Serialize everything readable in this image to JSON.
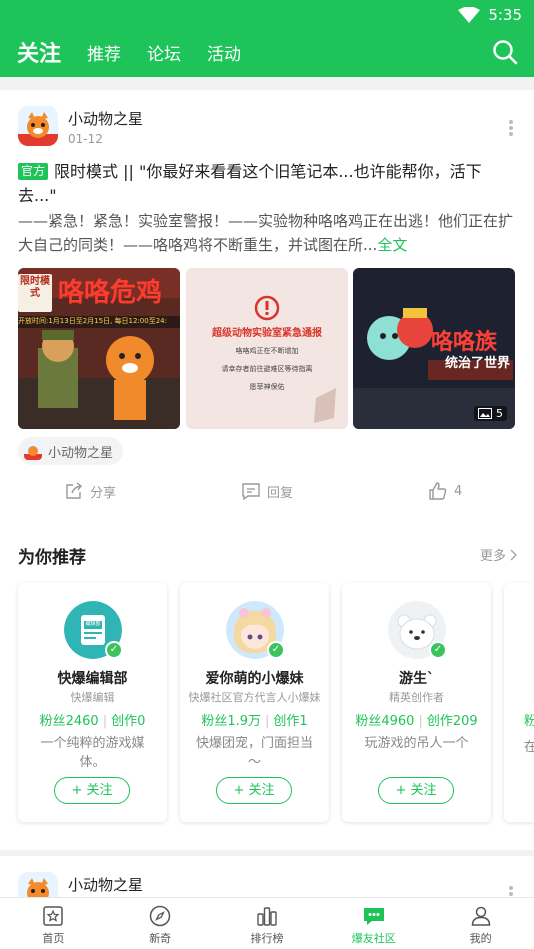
{
  "status_bar": {
    "time": "5:35"
  },
  "nav": {
    "tabs": [
      {
        "label": "关注",
        "active": true
      },
      {
        "label": "推荐",
        "active": false
      },
      {
        "label": "论坛",
        "active": false
      },
      {
        "label": "活动",
        "active": false
      }
    ],
    "search_icon": "search-icon"
  },
  "post": {
    "author": "小动物之星",
    "date": "01-12",
    "official_tag": "官方",
    "title": "限时模式 || \"你最好来看看这个旧笔记本...也许能帮你，活下去...\"",
    "excerpt": "——紧急！紧急！实验室警报！——实验物种咯咯鸡正在出逃！他们正在扩大自己的同类！——咯咯鸡将不断重生，并试图在所...",
    "full_text_link": "全文",
    "images": [
      {
        "banner": "咯咯危鸡",
        "tag": "限时模式",
        "date_text": "开放时间:1月13日至2月15日, 每日12:00至24:",
        "label": "限时"
      },
      {
        "heading": "超级动物实验室紧急通报",
        "lines": [
          "咯咯鸡正在不断增加",
          "请幸存者前往避难区等待指离",
          "愿菲神保佑"
        ]
      },
      {
        "banner": "咯咯族",
        "sub": "统治了世界",
        "count": "5"
      }
    ],
    "game_tag": "小动物之星",
    "actions": {
      "share": "分享",
      "reply": "回复",
      "like_count": "4"
    }
  },
  "recommend": {
    "title": "为你推荐",
    "more": "更多",
    "users": [
      {
        "name": "快爆编辑部",
        "title": "快爆编辑",
        "fans": "粉丝2460",
        "works": "创作0",
        "desc": "一个纯粹的游戏媒体。",
        "follow": "+ 关注",
        "avatar_text": "编辑部"
      },
      {
        "name": "爱你萌的小爆妹",
        "title": "快爆社区官方代言人小爆妹",
        "fans": "粉丝1.9万",
        "works": "创作1",
        "desc": "快爆团宠，门面担当～",
        "follow": "+ 关注"
      },
      {
        "name": "游生`",
        "title": "精英创作者",
        "fans": "粉丝4960",
        "works": "创作209",
        "desc": "玩游戏的吊人一个",
        "follow": "+ 关注"
      },
      {
        "fans": "粉",
        "desc": "在"
      }
    ]
  },
  "post2": {
    "author": "小动物之星"
  },
  "bottom_nav": [
    {
      "label": "首页",
      "icon": "home-star-icon",
      "active": false
    },
    {
      "label": "新奇",
      "icon": "compass-icon",
      "active": false
    },
    {
      "label": "排行榜",
      "icon": "ranking-bars-icon",
      "active": false
    },
    {
      "label": "爆友社区",
      "icon": "chat-bubble-icon",
      "active": true
    },
    {
      "label": "我的",
      "icon": "user-icon",
      "active": false
    }
  ],
  "colors": {
    "accent": "#1ec45a",
    "background": "#f2f2f2"
  }
}
